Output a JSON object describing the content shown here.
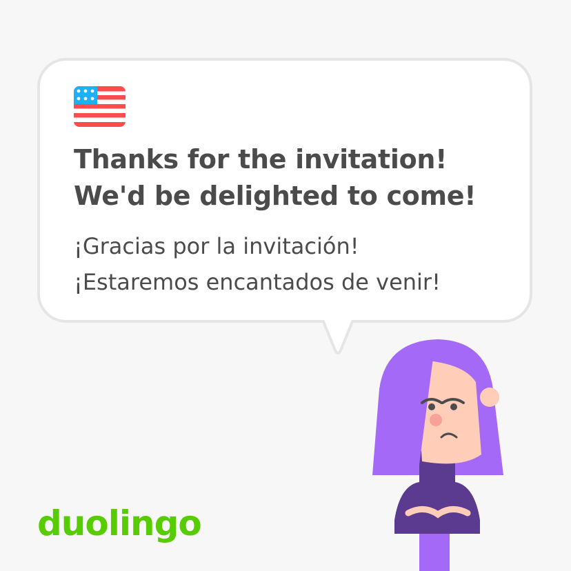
{
  "card": {
    "english": "Thanks for the invitation! We'd be delighted to come!",
    "spanish": "¡Gracias por la invitación!\n¡Estaremos encantados de venir!",
    "flag_icon": "us-flag-icon"
  },
  "brand": {
    "logo_text": "duolingo",
    "logo_color": "#58cc02"
  },
  "character": {
    "icon": "lily-character-illustration",
    "hair_color": "#a569f7",
    "shirt_color": "#5b3b8f",
    "skin_color": "#ffcdb8"
  },
  "colors": {
    "background": "#f7f7f7",
    "bubble_border": "#e5e5e5",
    "text": "#4b4b4b"
  }
}
